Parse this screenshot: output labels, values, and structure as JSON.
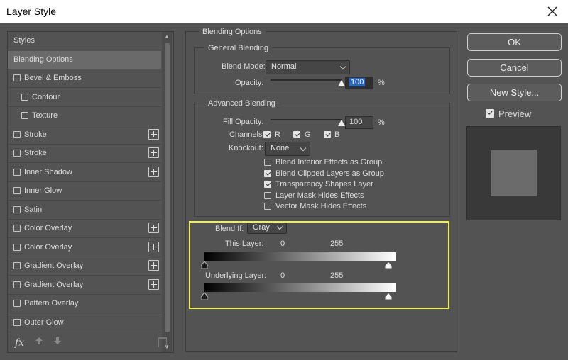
{
  "window": {
    "title": "Layer Style",
    "close_icon": "close-icon"
  },
  "styles_list": {
    "items": [
      {
        "label": "Styles",
        "checkbox": false,
        "plus": false,
        "indent": 0,
        "active": false
      },
      {
        "label": "Blending Options",
        "checkbox": false,
        "plus": false,
        "indent": 0,
        "active": true
      },
      {
        "label": "Bevel & Emboss",
        "checkbox": true,
        "plus": false,
        "indent": 0,
        "active": false
      },
      {
        "label": "Contour",
        "checkbox": true,
        "plus": false,
        "indent": 1,
        "active": false
      },
      {
        "label": "Texture",
        "checkbox": true,
        "plus": false,
        "indent": 1,
        "active": false
      },
      {
        "label": "Stroke",
        "checkbox": true,
        "plus": true,
        "indent": 0,
        "active": false
      },
      {
        "label": "Stroke",
        "checkbox": true,
        "plus": true,
        "indent": 0,
        "active": false
      },
      {
        "label": "Inner Shadow",
        "checkbox": true,
        "plus": true,
        "indent": 0,
        "active": false
      },
      {
        "label": "Inner Glow",
        "checkbox": true,
        "plus": false,
        "indent": 0,
        "active": false
      },
      {
        "label": "Satin",
        "checkbox": true,
        "plus": false,
        "indent": 0,
        "active": false
      },
      {
        "label": "Color Overlay",
        "checkbox": true,
        "plus": true,
        "indent": 0,
        "active": false
      },
      {
        "label": "Color Overlay",
        "checkbox": true,
        "plus": true,
        "indent": 0,
        "active": false
      },
      {
        "label": "Gradient Overlay",
        "checkbox": true,
        "plus": true,
        "indent": 0,
        "active": false
      },
      {
        "label": "Gradient Overlay",
        "checkbox": true,
        "plus": true,
        "indent": 0,
        "active": false
      },
      {
        "label": "Pattern Overlay",
        "checkbox": true,
        "plus": false,
        "indent": 0,
        "active": false
      },
      {
        "label": "Outer Glow",
        "checkbox": true,
        "plus": false,
        "indent": 0,
        "active": false
      }
    ],
    "footer": {
      "fx_label": "fx",
      "up_icon": "arrow-up-icon",
      "down_icon": "arrow-down-icon",
      "trash_icon": "trash-icon"
    }
  },
  "blending": {
    "title": "Blending Options",
    "general": {
      "title": "General Blending",
      "blend_mode_label": "Blend Mode:",
      "blend_mode_value": "Normal",
      "opacity_label": "Opacity:",
      "opacity_value": "100",
      "opacity_unit": "%",
      "opacity_level": 1.0
    },
    "advanced": {
      "title": "Advanced Blending",
      "fill_opacity_label": "Fill Opacity:",
      "fill_opacity_value": "100",
      "fill_opacity_unit": "%",
      "fill_opacity_level": 1.0,
      "channels_label": "Channels:",
      "channels": [
        {
          "label": "R",
          "checked": true
        },
        {
          "label": "G",
          "checked": true
        },
        {
          "label": "B",
          "checked": true
        }
      ],
      "knockout_label": "Knockout:",
      "knockout_value": "None",
      "options": [
        {
          "label": "Blend Interior Effects as Group",
          "checked": false
        },
        {
          "label": "Blend Clipped Layers as Group",
          "checked": true
        },
        {
          "label": "Transparency Shapes Layer",
          "checked": true
        },
        {
          "label": "Layer Mask Hides Effects",
          "checked": false
        },
        {
          "label": "Vector Mask Hides Effects",
          "checked": false
        }
      ]
    },
    "blend_if": {
      "label": "Blend If:",
      "value": "Gray",
      "this_layer": {
        "label": "This Layer:",
        "low": "0",
        "high": "255"
      },
      "underlying_layer": {
        "label": "Underlying Layer:",
        "low": "0",
        "high": "255"
      }
    }
  },
  "buttons": {
    "ok": "OK",
    "cancel": "Cancel",
    "new_style": "New Style..."
  },
  "preview": {
    "label": "Preview",
    "checked": true
  },
  "colors": {
    "highlight_border": "#f0f050",
    "selection": "#2266cc"
  }
}
